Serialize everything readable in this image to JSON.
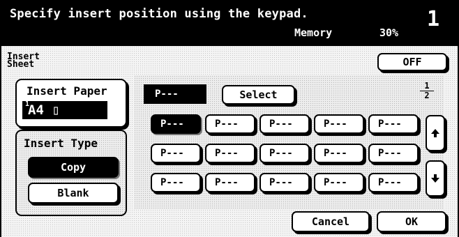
{
  "header": {
    "message": "Specify insert position using the keypad.",
    "memory_label": "Memory",
    "memory_value": "30%",
    "count": "1"
  },
  "title": "Insert Sheet",
  "off_label": "OFF",
  "insert_paper": {
    "label": "Insert Paper",
    "tray": "1",
    "value": "A4 ▯"
  },
  "insert_type": {
    "label": "Insert Type",
    "options": [
      "Copy",
      "Blank"
    ],
    "selected": "Copy"
  },
  "current_position": "P---",
  "select_label": "Select",
  "page": {
    "current": "1",
    "total": "2"
  },
  "grid_cells": [
    "P---",
    "P---",
    "P---",
    "P---",
    "P---",
    "P---",
    "P---",
    "P---",
    "P---",
    "P---",
    "P---",
    "P---",
    "P---",
    "P---",
    "P---"
  ],
  "scroll_up_icon": "up-arrow-icon",
  "scroll_down_icon": "down-arrow-icon",
  "cancel_label": "Cancel",
  "ok_label": "OK"
}
